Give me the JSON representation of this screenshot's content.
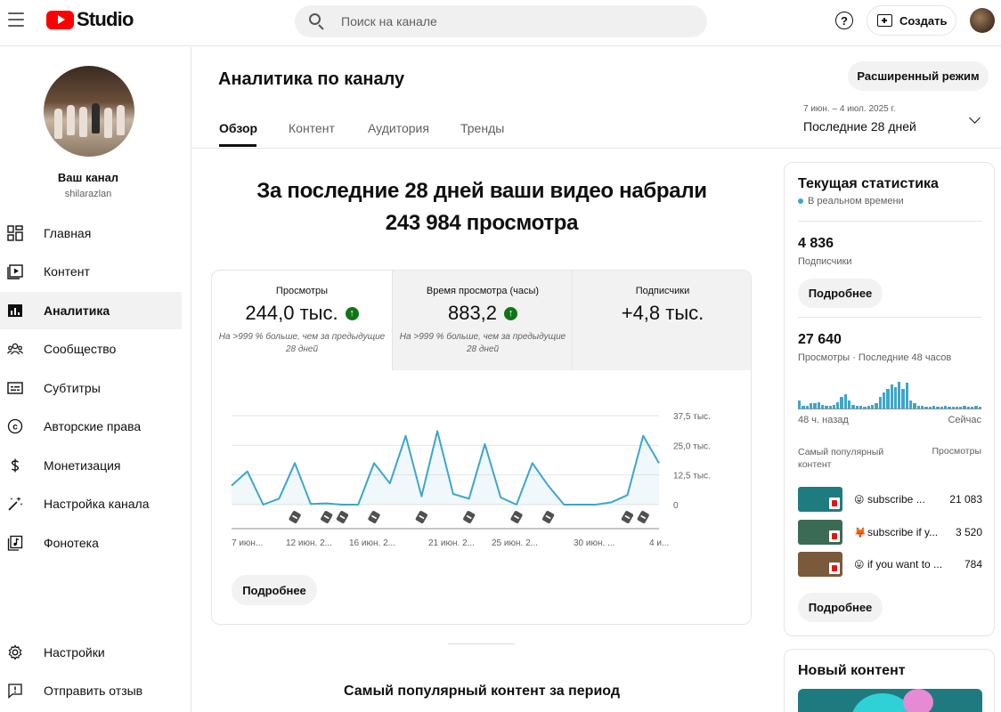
{
  "topbar": {
    "logo_text": "Studio",
    "search_placeholder": "Поиск на канале",
    "help_label": "?",
    "create_label": "Создать"
  },
  "sidebar": {
    "channel_name": "Ваш канал",
    "channel_handle": "shilarazlan",
    "items": [
      {
        "label": "Главная",
        "icon": "dashboard-icon"
      },
      {
        "label": "Контент",
        "icon": "content-icon"
      },
      {
        "label": "Аналитика",
        "icon": "analytics-icon",
        "active": true
      },
      {
        "label": "Сообщество",
        "icon": "community-icon"
      },
      {
        "label": "Субтитры",
        "icon": "subtitles-icon"
      },
      {
        "label": "Авторские права",
        "icon": "copyright-icon"
      },
      {
        "label": "Монетизация",
        "icon": "monetization-icon"
      },
      {
        "label": "Настройка канала",
        "icon": "customization-icon"
      },
      {
        "label": "Фонотека",
        "icon": "audio-library-icon"
      }
    ],
    "bottom_items": [
      {
        "label": "Настройки",
        "icon": "settings-icon"
      },
      {
        "label": "Отправить отзыв",
        "icon": "feedback-icon"
      }
    ]
  },
  "header": {
    "title": "Аналитика по каналу",
    "advanced_mode": "Расширенный режим",
    "tabs": [
      "Обзор",
      "Контент",
      "Аудитория",
      "Тренды"
    ],
    "active_tab": "Обзор",
    "date_range": "7 июн. – 4 июл. 2025 г.",
    "period_label": "Последние 28 дней"
  },
  "overview": {
    "headline_line1": "За последние 28 дней ваши видео набрали",
    "headline_line2": "243 984 просмотра",
    "metrics": [
      {
        "label": "Просмотры",
        "value": "244,0 тыс.",
        "trend": "up",
        "note": "На >999 % больше, чем за предыдущие 28 дней"
      },
      {
        "label": "Время просмотра (часы)",
        "value": "883,2",
        "trend": "up",
        "note": "На >999 % больше, чем за предыдущие 28 дней"
      },
      {
        "label": "Подписчики",
        "value": "+4,8 тыс.",
        "trend": "none",
        "note": ""
      }
    ],
    "more_button": "Подробнее",
    "popular_title": "Самый популярный контент за период"
  },
  "chart_data": {
    "type": "line",
    "title": "",
    "xlabel": "",
    "ylabel": "",
    "x_ticks": [
      "7 июн...",
      "12 июн. 2...",
      "16 июн. 2...",
      "21 июн. 2...",
      "25 июн. 2...",
      "30 июн. ...",
      "4 и..."
    ],
    "y_ticks": [
      "37,5 тыс.",
      "25,0 тыс.",
      "12,5 тыс.",
      "0"
    ],
    "ylim": [
      0,
      37500
    ],
    "series": [
      {
        "values": [
          8000,
          14000,
          0,
          2500,
          17500,
          300,
          500,
          0,
          0,
          17500,
          9000,
          29000,
          3500,
          31000,
          4500,
          2500,
          25500,
          3000,
          0,
          17500,
          8000,
          0,
          0,
          0,
          1000,
          4000,
          29000,
          17500
        ],
        "color": "#3ea6c9"
      }
    ],
    "video_marker_days": [
      4,
      6,
      7,
      9,
      12,
      15,
      18,
      20,
      25,
      26
    ]
  },
  "realtime": {
    "title": "Текущая статистика",
    "live_label": "В реальном времени",
    "subscribers_value": "4 836",
    "subscribers_label": "Подписчики",
    "more_button": "Подробнее",
    "views_value": "27 640",
    "views_label": "Просмотры · Последние 48 часов",
    "bars_hours": [
      8,
      3,
      3,
      5,
      5,
      6,
      4,
      3,
      3,
      4,
      6,
      12,
      14,
      8,
      4,
      3,
      3,
      2,
      3,
      4,
      5,
      12,
      16,
      20,
      24,
      22,
      27,
      20,
      26,
      8,
      5,
      3,
      3,
      2,
      2,
      3,
      2,
      2,
      3,
      2,
      2,
      2,
      2,
      3,
      2,
      2,
      3,
      2
    ],
    "axis_left": "48 ч. назад",
    "axis_right": "Сейчас",
    "col_content": "Самый популярный контент",
    "col_views": "Просмотры",
    "top_videos": [
      {
        "emoji": "😜",
        "title": "subscribe ...",
        "views": "21 083",
        "thumb_color": "#1e7c80"
      },
      {
        "emoji": "🦊",
        "title": "subscribe if y...",
        "views": "3 520",
        "thumb_color": "#3b6b55"
      },
      {
        "emoji": "😛",
        "title": "if you want to ...",
        "views": "784",
        "thumb_color": "#7a5a3a"
      }
    ],
    "more_button2": "Подробнее"
  },
  "new_content": {
    "title": "Новый контент"
  }
}
